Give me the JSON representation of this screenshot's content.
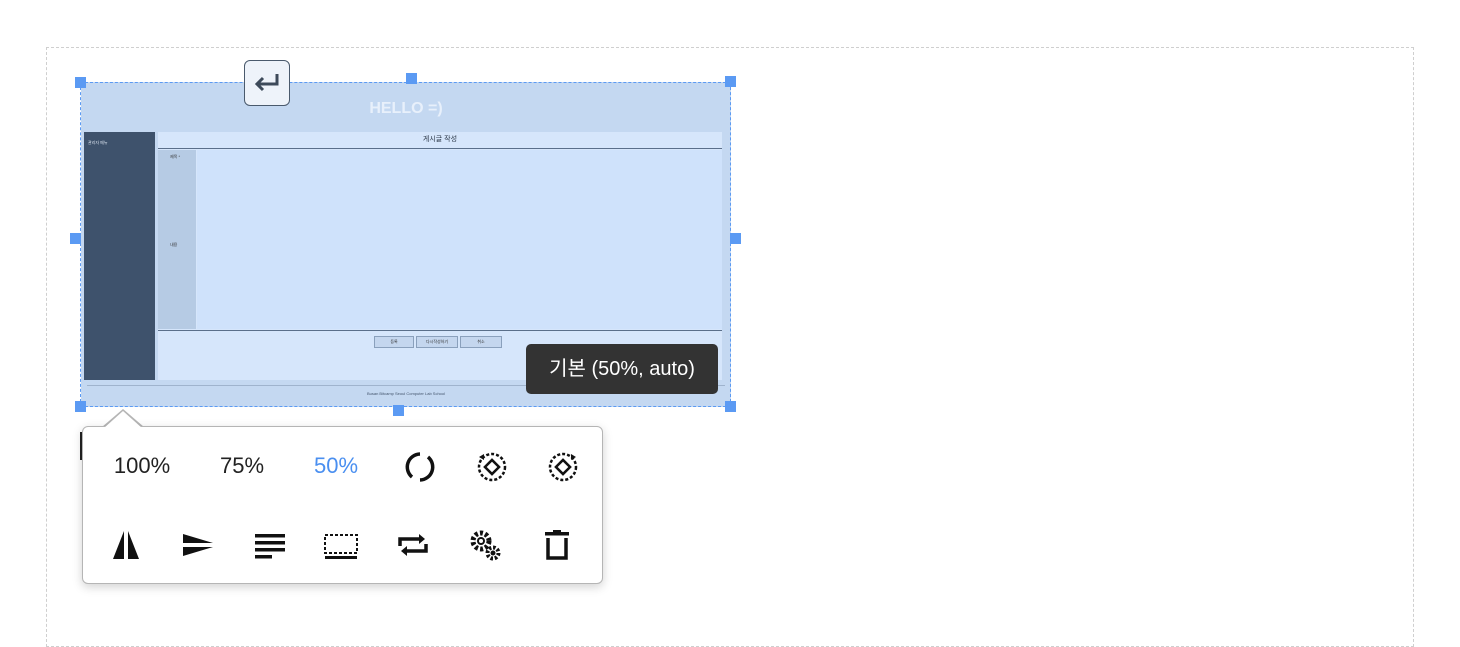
{
  "image": {
    "title": "HELLO =)",
    "sidebar_text": "관리자 메뉴",
    "form_heading": "게시글 작성",
    "label_title": "제목 *",
    "label_content": "내용",
    "buttons": [
      "등록",
      "다시작성하기",
      "취소"
    ],
    "footer": "Busan Bitcamp Seoul Computer Lab School"
  },
  "tooltip": {
    "text": "기본 (50%, auto)"
  },
  "toolbar": {
    "size_options": [
      "100%",
      "75%",
      "50%"
    ],
    "active_size": "50%",
    "icons": [
      "rotate-icon",
      "rotate-left-icon",
      "rotate-right-icon",
      "flip-horizontal-icon",
      "flip-vertical-icon",
      "align-icon",
      "caption-icon",
      "replace-icon",
      "settings-icon",
      "delete-icon"
    ]
  },
  "colors": {
    "accent": "#4a8ff0",
    "handle": "#5b9af3",
    "tooltip_bg": "#333333"
  }
}
